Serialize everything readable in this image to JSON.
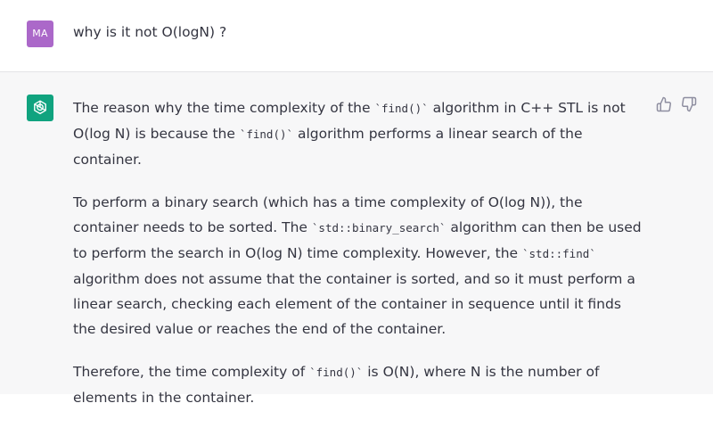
{
  "user": {
    "avatar_initials": "MA",
    "message": "why is it not O(logN) ?"
  },
  "assistant": {
    "paragraphs": [
      [
        {
          "t": "text",
          "v": "The reason why the time complexity of the "
        },
        {
          "t": "code",
          "v": "`find()`"
        },
        {
          "t": "text",
          "v": " algorithm in C++ STL is not O(log N) is because the "
        },
        {
          "t": "code",
          "v": "`find()`"
        },
        {
          "t": "text",
          "v": " algorithm performs a linear search of the container."
        }
      ],
      [
        {
          "t": "text",
          "v": "To perform a binary search (which has a time complexity of O(log N)), the container needs to be sorted. The "
        },
        {
          "t": "code",
          "v": "`std::binary_search`"
        },
        {
          "t": "text",
          "v": " algorithm can then be used to perform the search in O(log N) time complexity. However, the "
        },
        {
          "t": "code",
          "v": "`std::find`"
        },
        {
          "t": "text",
          "v": " algorithm does not assume that the container is sorted, and so it must perform a linear search, checking each element of the container in sequence until it finds the desired value or reaches the end of the container."
        }
      ],
      [
        {
          "t": "text",
          "v": "Therefore, the time complexity of "
        },
        {
          "t": "code",
          "v": "`find()`"
        },
        {
          "t": "text",
          "v": " is O(N), where N is the number of elements in the container."
        }
      ]
    ],
    "actions": [
      {
        "name": "thumbs-up-button",
        "icon": "thumbs-up-icon"
      },
      {
        "name": "thumbs-down-button",
        "icon": "thumbs-down-icon"
      }
    ]
  },
  "colors": {
    "user_avatar": "#ab68c9",
    "bot_avatar": "#10a37f",
    "assistant_bg": "#f7f7f8",
    "text": "#343541"
  }
}
